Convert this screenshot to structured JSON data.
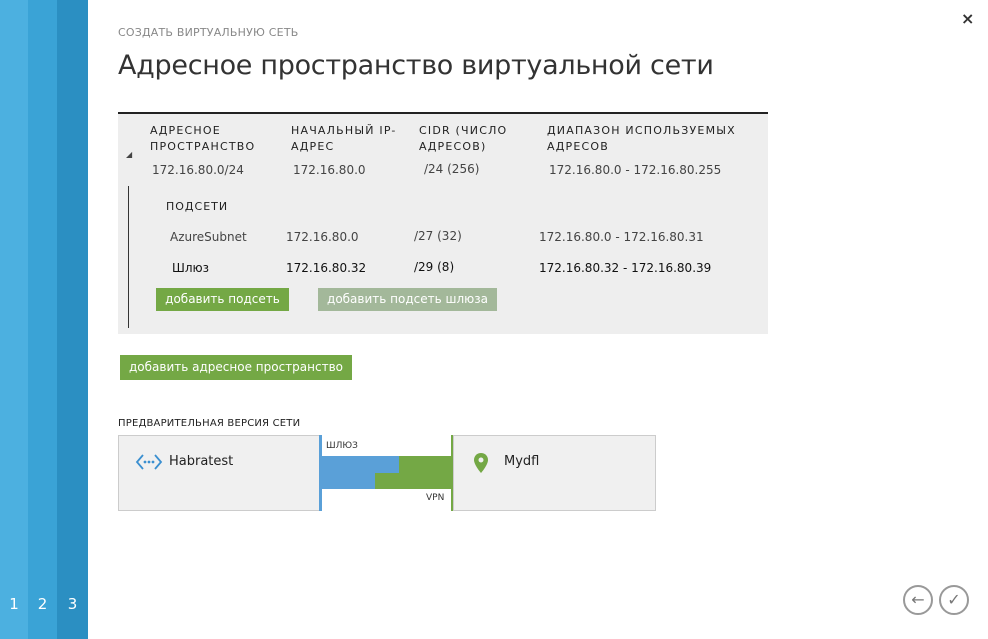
{
  "wizard": {
    "caption": "СОЗДАТЬ ВИРТУАЛЬНУЮ СЕТЬ",
    "title": "Адресное пространство виртуальной сети",
    "steps": [
      "1",
      "2",
      "3"
    ],
    "close_glyph": "×"
  },
  "address_space": {
    "headers": {
      "space": [
        "АДРЕСНОЕ",
        "ПРОСТРАНСТВО"
      ],
      "start_ip": [
        "НАЧАЛЬНЫЙ IP-",
        "АДРЕС"
      ],
      "cidr": [
        "CIDR (ЧИСЛО",
        "АДРЕСОВ)"
      ],
      "range": [
        "ДИАПАЗОН ИСПОЛЬЗУЕМЫХ",
        "АДРЕСОВ"
      ]
    },
    "row": {
      "space": "172.16.80.0/24",
      "start_ip": "172.16.80.0",
      "cidr": "/24 (256)",
      "range": "172.16.80.0 - 172.16.80.255"
    },
    "subnets_label": "ПОДСЕТИ",
    "subnets": [
      {
        "name": "AzureSubnet",
        "start_ip": "172.16.80.0",
        "cidr": "/27 (32)",
        "range": "172.16.80.0 - 172.16.80.31"
      },
      {
        "name": "Шлюз",
        "start_ip": "172.16.80.32",
        "cidr": "/29 (8)",
        "range": "172.16.80.32 - 172.16.80.39"
      }
    ],
    "add_subnet_label": "добавить подсеть",
    "add_gateway_subnet_label": "добавить подсеть шлюза"
  },
  "add_address_space_label": "добавить адресное пространство",
  "preview": {
    "label": "ПРЕДВАРИТЕЛЬНАЯ ВЕРСИЯ СЕТИ",
    "left_site": "Habratest",
    "right_site": "Mydfl",
    "gateway_label": "ШЛЮЗ",
    "vpn_label": "VPN",
    "colors": {
      "blue": "#5aa0d8",
      "green": "#74a845"
    }
  },
  "navigation": {
    "back_icon": "arrow-left-icon",
    "finish_icon": "checkmark-icon"
  }
}
